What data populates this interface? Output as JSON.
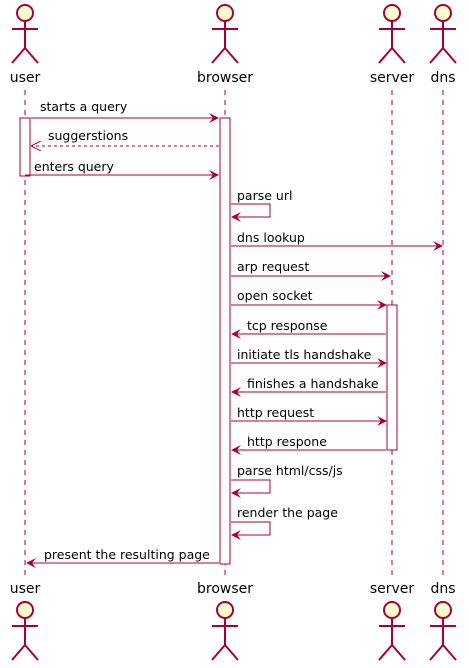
{
  "actors": [
    {
      "id": "user",
      "label": "user"
    },
    {
      "id": "browser",
      "label": "browser"
    },
    {
      "id": "server",
      "label": "server"
    },
    {
      "id": "dns",
      "label": "dns"
    }
  ],
  "messages": [
    {
      "from": "user",
      "to": "browser",
      "label": "starts a query",
      "style": "solid"
    },
    {
      "from": "browser",
      "to": "user",
      "label": "suggerstions",
      "style": "dashed"
    },
    {
      "from": "user",
      "to": "browser",
      "label": "enters query",
      "style": "solid"
    },
    {
      "from": "browser",
      "to": "browser",
      "label": "parse url",
      "style": "self"
    },
    {
      "from": "browser",
      "to": "dns",
      "label": "dns lookup",
      "style": "solid"
    },
    {
      "from": "browser",
      "to": "server",
      "label": "arp request",
      "style": "solid"
    },
    {
      "from": "browser",
      "to": "server",
      "label": "open socket",
      "style": "solid"
    },
    {
      "from": "server",
      "to": "browser",
      "label": "tcp response",
      "style": "solid"
    },
    {
      "from": "browser",
      "to": "server",
      "label": "initiate tls handshake",
      "style": "solid"
    },
    {
      "from": "server",
      "to": "browser",
      "label": "finishes a handshake",
      "style": "solid"
    },
    {
      "from": "browser",
      "to": "server",
      "label": "http request",
      "style": "solid"
    },
    {
      "from": "server",
      "to": "browser",
      "label": "http respone",
      "style": "solid"
    },
    {
      "from": "browser",
      "to": "browser",
      "label": "parse html/css/js",
      "style": "self"
    },
    {
      "from": "browser",
      "to": "browser",
      "label": "render the page",
      "style": "self"
    },
    {
      "from": "browser",
      "to": "user",
      "label": "present the resulting page",
      "style": "solid"
    }
  ],
  "colors": {
    "line": "#A80036",
    "actor_fill": "#FEFECE",
    "activation_fill": "#FFFFFF",
    "text": "#000000"
  }
}
